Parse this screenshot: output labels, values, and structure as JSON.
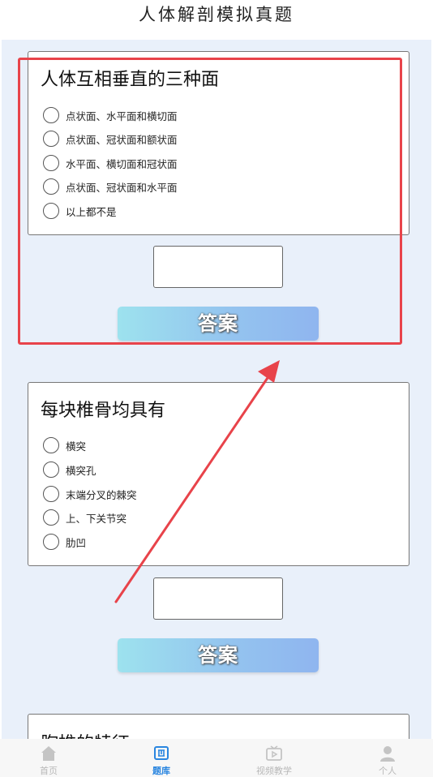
{
  "header": {
    "title": "人体解剖模拟真题"
  },
  "questions": [
    {
      "title": "人体互相垂直的三种面",
      "options": [
        "点状面、水平面和横切面",
        "点状面、冠状面和额状面",
        "水平面、横切面和冠状面",
        "点状面、冠状面和水平面",
        "以上都不是"
      ],
      "answer_value": "",
      "answer_button": "答案"
    },
    {
      "title": "每块椎骨均具有",
      "options": [
        "横突",
        "横突孔",
        "末端分叉的棘突",
        "上、下关节突",
        "肋凹"
      ],
      "answer_value": "",
      "answer_button": "答案"
    },
    {
      "title": "胸椎的特征"
    }
  ],
  "tabbar": {
    "items": [
      {
        "label": "首页",
        "icon": "home-icon",
        "active": false
      },
      {
        "label": "题库",
        "icon": "question-bank-icon",
        "active": true
      },
      {
        "label": "视频教学",
        "icon": "video-icon",
        "active": false
      },
      {
        "label": "个人",
        "icon": "person-icon",
        "active": false
      }
    ]
  },
  "colors": {
    "highlight": "#e8434a",
    "active_tab": "#2a86e0",
    "content_background": "#e9f0fa",
    "button_gradient_start": "#9de2ee",
    "button_gradient_end": "#8fb5ef"
  }
}
